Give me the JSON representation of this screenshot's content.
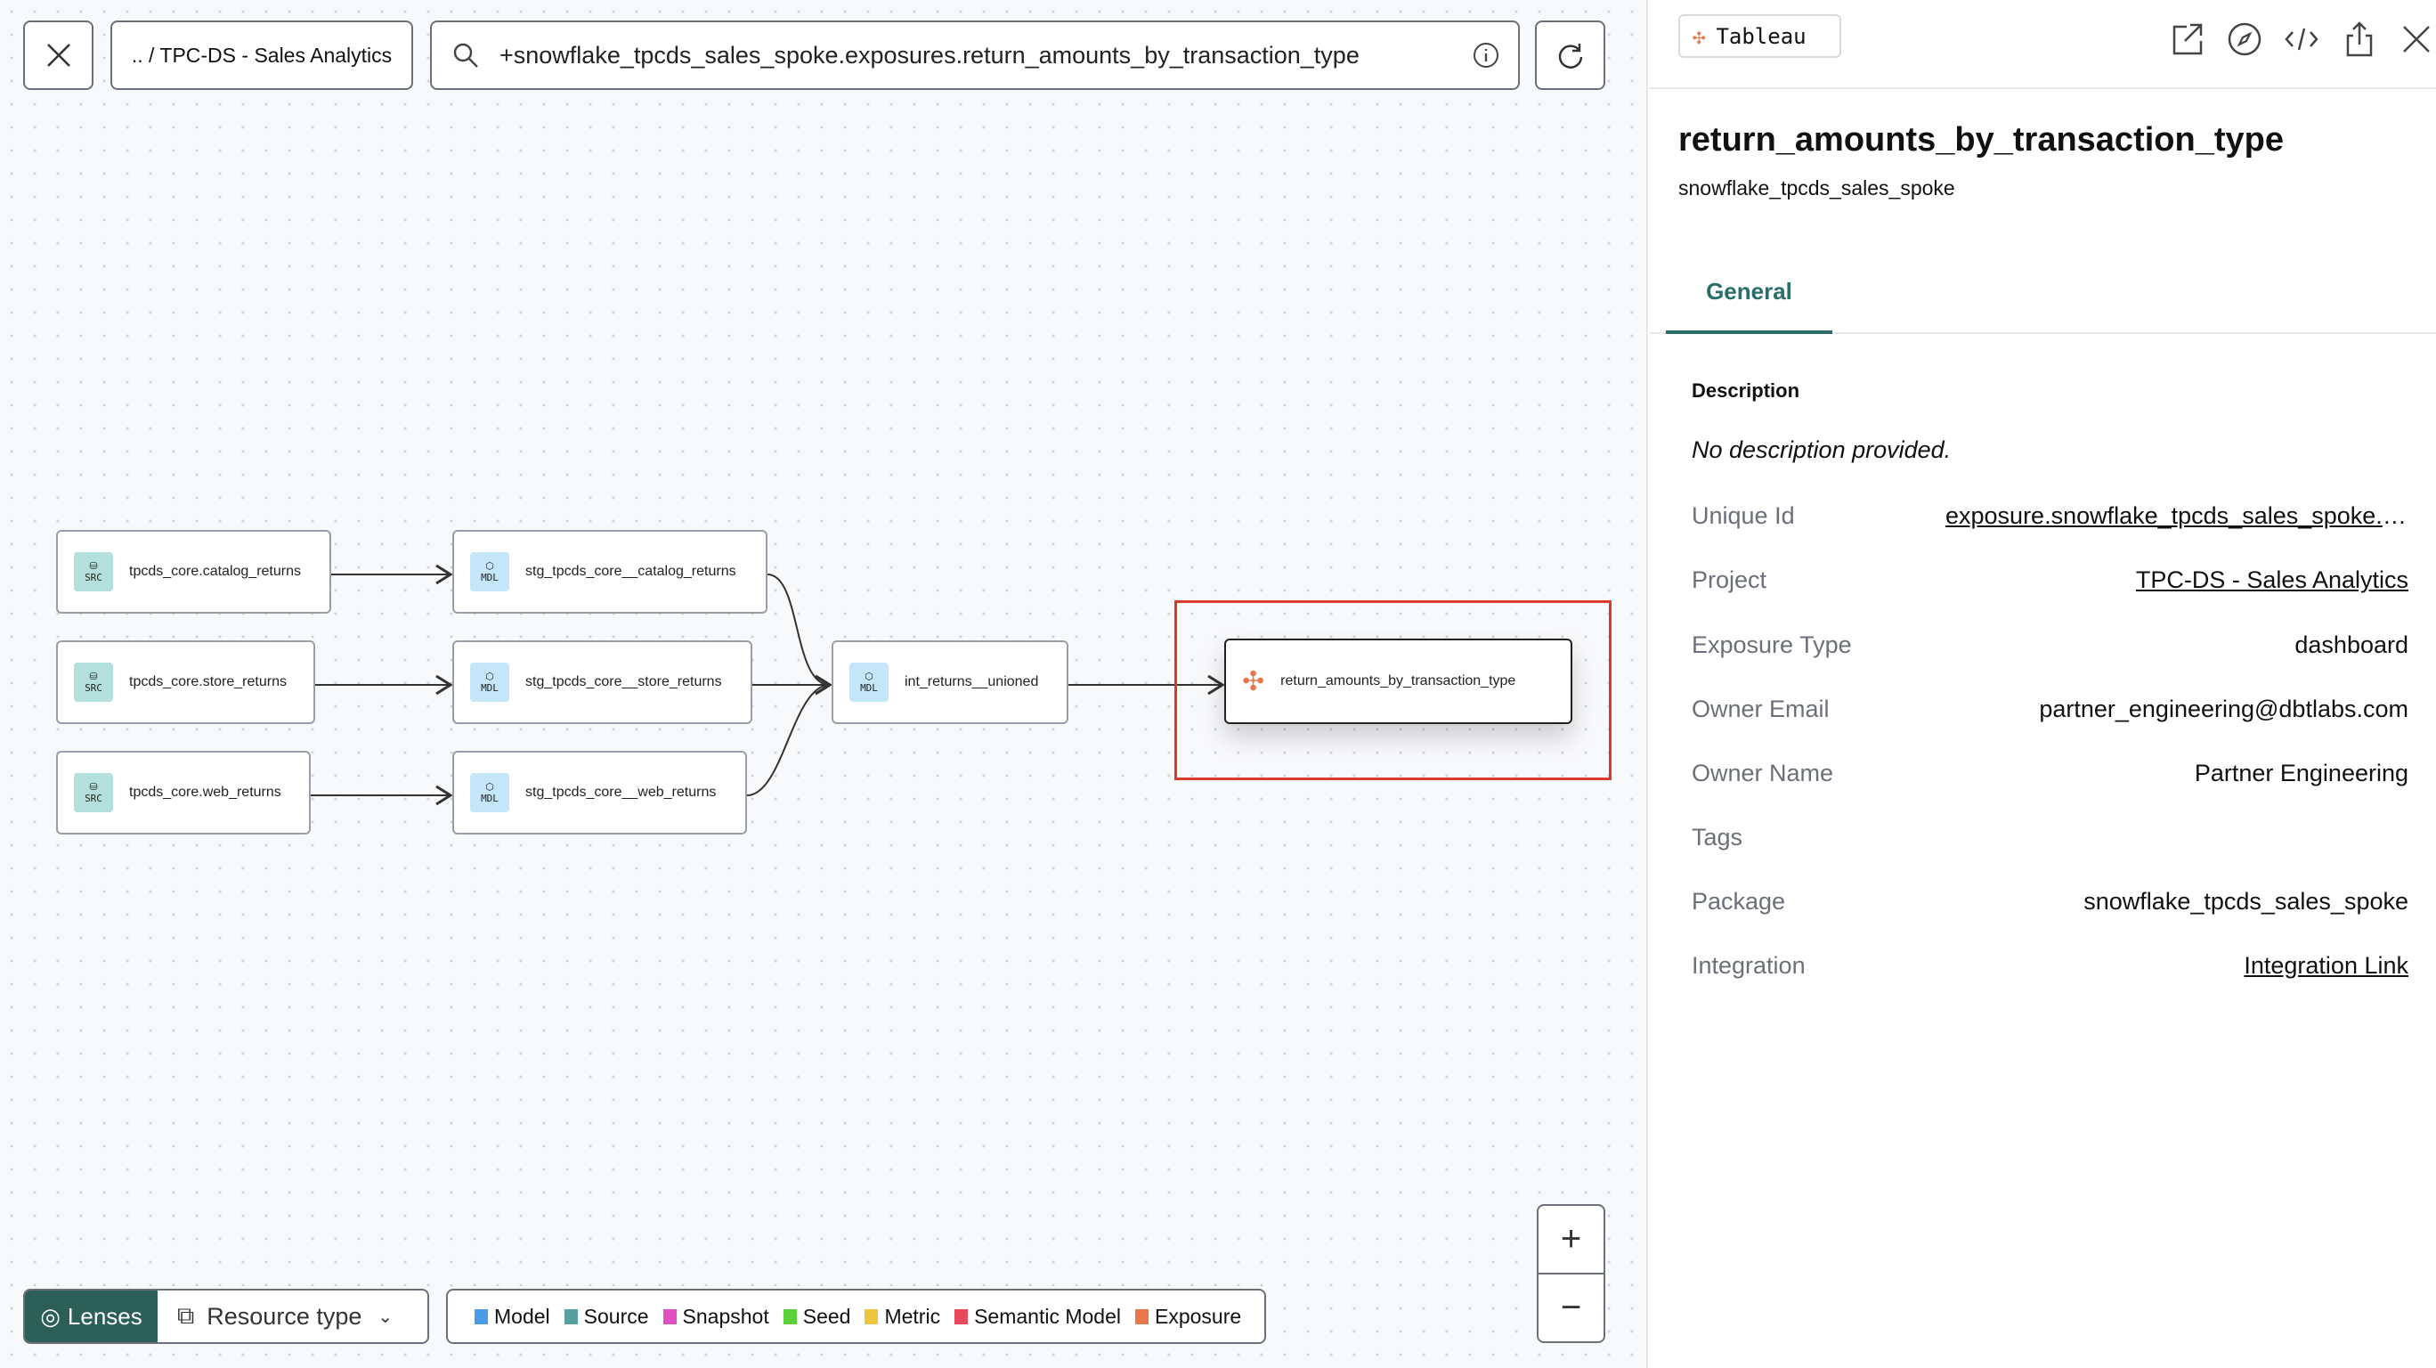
{
  "toolbar": {
    "breadcrumb": ".. / TPC-DS - Sales Analytics",
    "search_value": "+snowflake_tpcds_sales_spoke.exposures.return_amounts_by_transaction_type"
  },
  "graph": {
    "sources": [
      {
        "badge": "SRC",
        "label": "tpcds_core.catalog_returns"
      },
      {
        "badge": "SRC",
        "label": "tpcds_core.store_returns"
      },
      {
        "badge": "SRC",
        "label": "tpcds_core.web_returns"
      }
    ],
    "staging": [
      {
        "badge": "MDL",
        "label": "stg_tpcds_core__catalog_returns"
      },
      {
        "badge": "MDL",
        "label": "stg_tpcds_core__store_returns"
      },
      {
        "badge": "MDL",
        "label": "stg_tpcds_core__web_returns"
      }
    ],
    "intermediate": {
      "badge": "MDL",
      "label": "int_returns__unioned"
    },
    "exposure": {
      "label": "return_amounts_by_transaction_type"
    },
    "highlight_color": "#d93a2b"
  },
  "bottom": {
    "lenses": "Lenses",
    "resource_type": "Resource type",
    "legend": [
      {
        "label": "Model",
        "color": "#4a9be6"
      },
      {
        "label": "Source",
        "color": "#5a9fa0"
      },
      {
        "label": "Snapshot",
        "color": "#e04fbf"
      },
      {
        "label": "Seed",
        "color": "#5ccf3a"
      },
      {
        "label": "Metric",
        "color": "#eec53f"
      },
      {
        "label": "Semantic Model",
        "color": "#e64a5c"
      },
      {
        "label": "Exposure",
        "color": "#e8784a"
      }
    ]
  },
  "panel": {
    "chip": "Tableau",
    "title": "return_amounts_by_transaction_type",
    "subtitle": "snowflake_tpcds_sales_spoke",
    "tab": "General",
    "description_label": "Description",
    "description": "No description provided.",
    "fields": [
      {
        "key": "Unique Id",
        "value": "exposure.snowflake_tpcds_sales_spoke.return_amounts_by_transaction_type",
        "link": true
      },
      {
        "key": "Project",
        "value": "TPC-DS - Sales Analytics",
        "link": true
      },
      {
        "key": "Exposure Type",
        "value": "dashboard"
      },
      {
        "key": "Owner Email",
        "value": "partner_engineering@dbtlabs.com"
      },
      {
        "key": "Owner Name",
        "value": "Partner Engineering"
      },
      {
        "key": "Tags",
        "value": ""
      },
      {
        "key": "Package",
        "value": "snowflake_tpcds_sales_spoke"
      },
      {
        "key": "Integration",
        "value": "Integration Link",
        "link": true
      }
    ],
    "accent": "#2a6e6a"
  }
}
